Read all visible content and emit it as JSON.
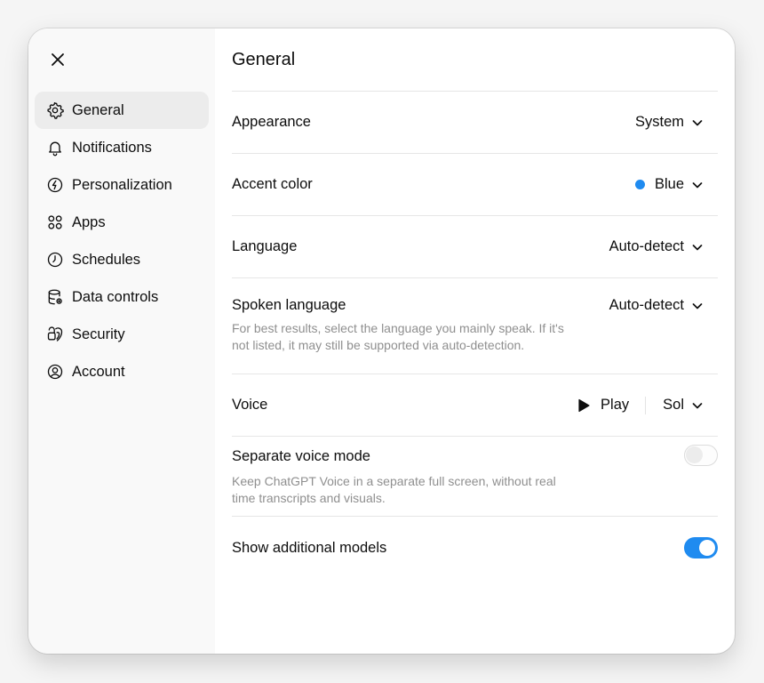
{
  "sidebar": {
    "items": [
      {
        "label": "General",
        "icon": "gear-icon"
      },
      {
        "label": "Notifications",
        "icon": "bell-icon"
      },
      {
        "label": "Personalization",
        "icon": "personalization-icon"
      },
      {
        "label": "Apps",
        "icon": "apps-grid-icon"
      },
      {
        "label": "Schedules",
        "icon": "clock-icon"
      },
      {
        "label": "Data controls",
        "icon": "database-icon"
      },
      {
        "label": "Security",
        "icon": "security-icon"
      },
      {
        "label": "Account",
        "icon": "user-circle-icon"
      }
    ],
    "active_index": 0
  },
  "main": {
    "title": "General",
    "appearance": {
      "label": "Appearance",
      "value": "System"
    },
    "accent_color": {
      "label": "Accent color",
      "value": "Blue",
      "color": "#1f8bf0"
    },
    "language": {
      "label": "Language",
      "value": "Auto-detect"
    },
    "spoken_language": {
      "label": "Spoken language",
      "value": "Auto-detect",
      "description": "For best results, select the language you mainly speak. If it's not listed, it may still be supported via auto-detection."
    },
    "voice": {
      "label": "Voice",
      "play_label": "Play",
      "value": "Sol"
    },
    "separate_voice_mode": {
      "label": "Separate voice mode",
      "description": "Keep ChatGPT Voice in a separate full screen, without real time transcripts and visuals.",
      "enabled": false
    },
    "show_additional_models": {
      "label": "Show additional models",
      "enabled": true
    }
  },
  "colors": {
    "accent": "#1f8bf0",
    "sidebar_bg": "#f9f9f9",
    "active_item_bg": "#ececec"
  }
}
